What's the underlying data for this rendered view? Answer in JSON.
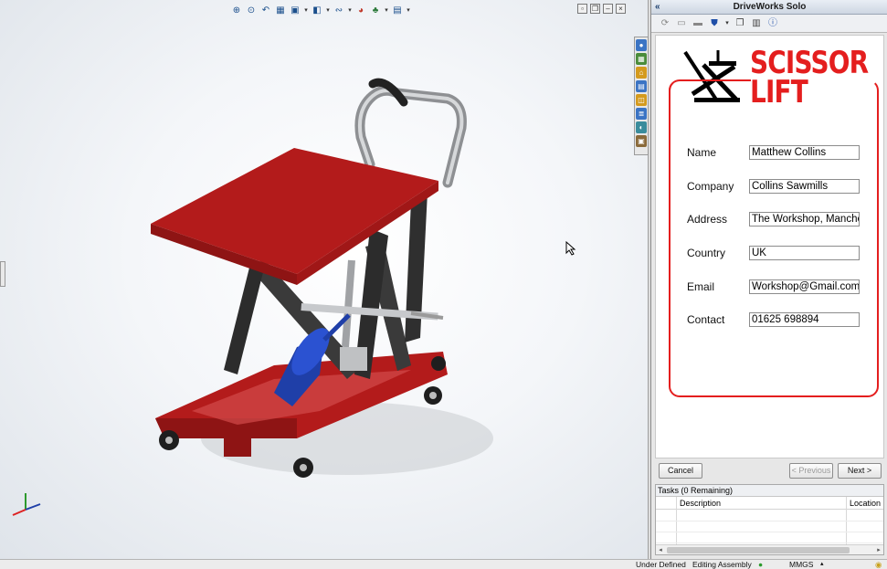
{
  "viewport": {
    "toolbar_icons": [
      "zoom-to-fit-icon",
      "zoom-area-icon",
      "previous-view-icon",
      "section-view-icon",
      "view-orientation-icon",
      "display-style-icon",
      "hide-show-icon",
      "edit-appearance-icon",
      "apply-scene-icon",
      "view-settings-icon"
    ],
    "window_controls": [
      "tile-icon",
      "restore-icon",
      "minimize-icon",
      "close-icon"
    ]
  },
  "task_tabs": [
    "resources-icon",
    "design-library-icon",
    "file-explorer-icon",
    "view-palette-icon",
    "appearances-icon",
    "custom-properties-icon",
    "driveworks-icon",
    "photoview-icon"
  ],
  "pane": {
    "title": "DriveWorks Solo",
    "collapse_glyph": "«",
    "logo": {
      "line1": "SCISSOR",
      "line2": "LIFT",
      "color": "#e41e1e"
    },
    "fields": [
      {
        "label": "Name",
        "value": "Matthew Collins"
      },
      {
        "label": "Company",
        "value": "Collins Sawmills"
      },
      {
        "label": "Address",
        "value": "The Workshop, Manches"
      },
      {
        "label": "Country",
        "value": "UK"
      },
      {
        "label": "Email",
        "value": "Workshop@Gmail.com"
      },
      {
        "label": "Contact",
        "value": "01625 698894"
      }
    ],
    "buttons": {
      "cancel": "Cancel",
      "previous": "< Previous",
      "next": "Next >"
    },
    "tasks": {
      "header": "Tasks (0 Remaining)",
      "col_description": "Description",
      "col_location": "Location"
    }
  },
  "status": {
    "state": "Under Defined",
    "mode": "Editing Assembly",
    "units": "MMGS"
  },
  "colors": {
    "accent": "#e41e1e",
    "table_red": "#b31b1b",
    "frame_dark": "#3a3a3a",
    "pump_blue": "#1f3fa8"
  }
}
